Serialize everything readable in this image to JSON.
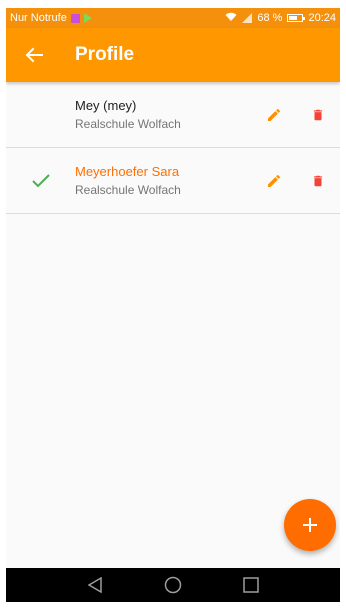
{
  "status_bar": {
    "carrier": "Nur Notrufe",
    "battery": "68 %",
    "time": "20:24"
  },
  "app_bar": {
    "title": "Profile",
    "back_icon": "arrow-back-icon"
  },
  "profiles": [
    {
      "name": "Mey (mey)",
      "school": "Realschule Wolfach",
      "selected": false
    },
    {
      "name": "Meyerhoefer Sara",
      "school": "Realschule Wolfach",
      "selected": true
    }
  ],
  "colors": {
    "status_bar": "#f4900c",
    "app_bar": "#ff9800",
    "accent": "#ff6d00",
    "edit_icon": "#ff8f00",
    "delete_icon": "#f44336",
    "check_icon": "#4caf50"
  },
  "icons": {
    "edit": "pencil-icon",
    "delete": "trash-icon",
    "selected": "check-icon",
    "fab": "plus-icon"
  }
}
